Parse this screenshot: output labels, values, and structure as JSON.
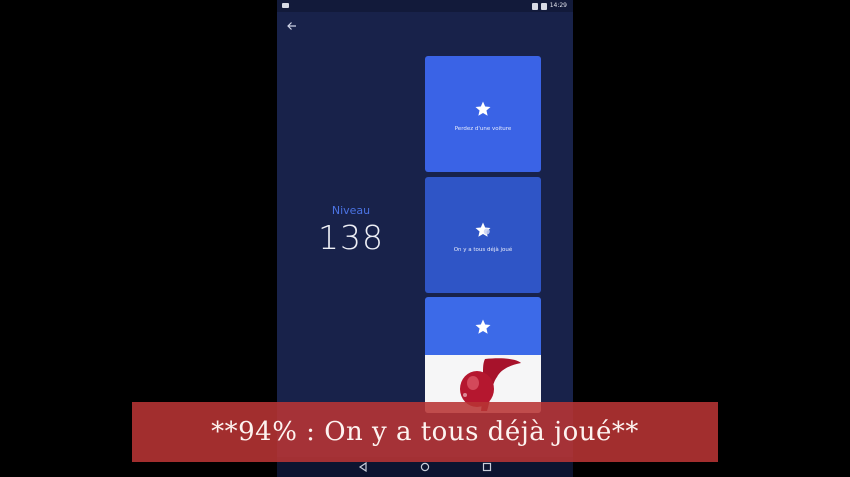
{
  "status_bar": {
    "time": "14:29"
  },
  "level": {
    "label": "Niveau",
    "value": "138"
  },
  "cards": [
    {
      "caption": "Perdez d'une voiture",
      "icon": "star-icon"
    },
    {
      "caption": "On y a tous déjà joué",
      "icon": "star-icon"
    },
    {
      "caption": "",
      "icon": "star-icon",
      "image": "red-wine-splash-image"
    }
  ],
  "overlay_caption": "**94% : On y a tous déjà joué**",
  "colors": {
    "background": "#18224a",
    "card_blue": "#3a63e6",
    "accent": "#4b73e3",
    "banner": "#b83434"
  }
}
